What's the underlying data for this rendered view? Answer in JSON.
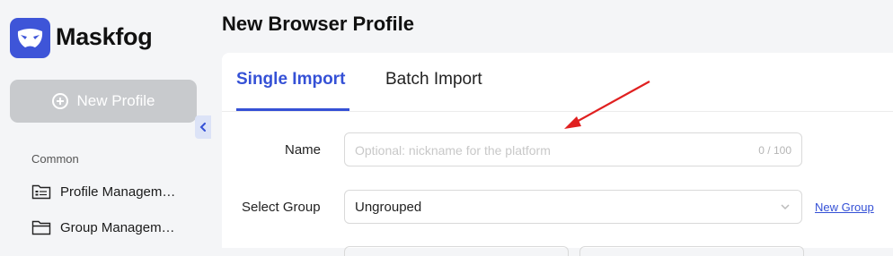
{
  "sidebar": {
    "brand": "Maskfog",
    "new_profile_label": "New Profile",
    "section_label": "Common",
    "items": [
      {
        "label": "Profile Managem…",
        "icon": "profile-list-icon"
      },
      {
        "label": "Group Managem…",
        "icon": "folder-icon"
      }
    ]
  },
  "main": {
    "title": "New Browser Profile",
    "tabs": [
      {
        "label": "Single Import",
        "active": true
      },
      {
        "label": "Batch Import",
        "active": false
      }
    ],
    "form": {
      "name_label": "Name",
      "name_placeholder": "Optional: nickname for the platform",
      "name_counter": "0 / 100",
      "group_label": "Select Group",
      "group_value": "Ungrouped",
      "new_group_link": "New Group"
    }
  },
  "colors": {
    "accent": "#3551d6",
    "logo": "#3e55d8",
    "button_disabled": "#c8cacd",
    "annotation_arrow": "#e02020"
  }
}
